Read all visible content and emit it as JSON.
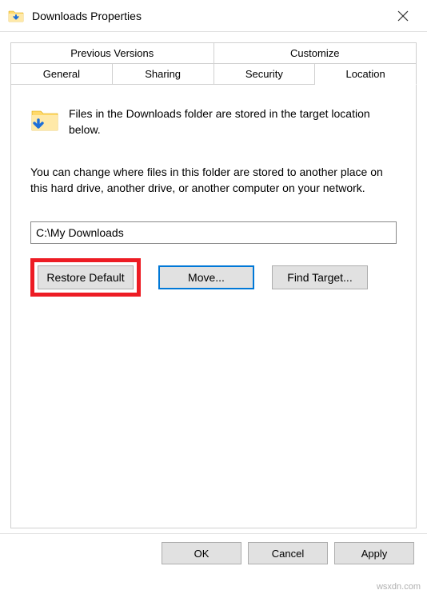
{
  "titlebar": {
    "title": "Downloads Properties"
  },
  "tabs": {
    "row1": [
      "Previous Versions",
      "Customize"
    ],
    "row2": [
      "General",
      "Sharing",
      "Security",
      "Location"
    ],
    "active": "Location"
  },
  "location": {
    "intro": "Files in the Downloads folder are stored in the target location below.",
    "description": "You can change where files in this folder are stored to another place on this hard drive, another drive, or another computer on your network.",
    "path_value": "C:\\My Downloads",
    "restore_label": "Restore Default",
    "move_label": "Move...",
    "findtarget_label": "Find Target..."
  },
  "footer": {
    "ok": "OK",
    "cancel": "Cancel",
    "apply": "Apply"
  },
  "watermark": "wsxdn.com"
}
